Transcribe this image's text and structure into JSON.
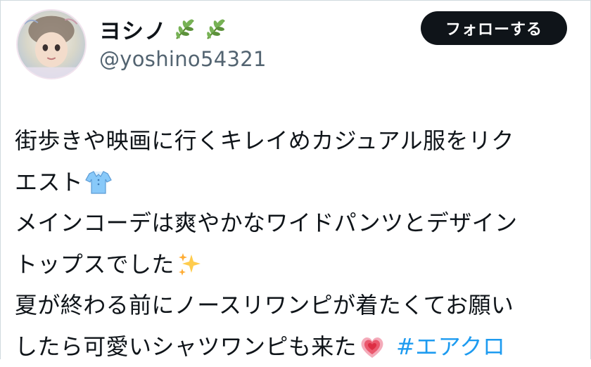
{
  "user": {
    "display_name": "ヨシノ",
    "handle": "@yoshino54321",
    "name_emojis": [
      "herb-icon",
      "herb-icon"
    ]
  },
  "actions": {
    "follow_label": "フォローする"
  },
  "tweet": {
    "lines": [
      "街歩きや映画に行くキレイめカジュアル服をリク",
      "エスト",
      "メインコーデは爽やかなワイドパンツとデザイン",
      "トップスでした",
      "夏が終わる前にノースリワンピが着たくてお願い",
      "したら可愛いシャツワンピも来た"
    ],
    "emojis": {
      "line2": "t-shirt-icon",
      "line4": "sparkles-icon",
      "line6": "growing-heart-icon"
    },
    "hashtag": "#エアクロ"
  },
  "colors": {
    "text": "#0f1419",
    "secondary": "#536471",
    "link": "#1d9bf0",
    "button_bg": "#0f1419"
  }
}
